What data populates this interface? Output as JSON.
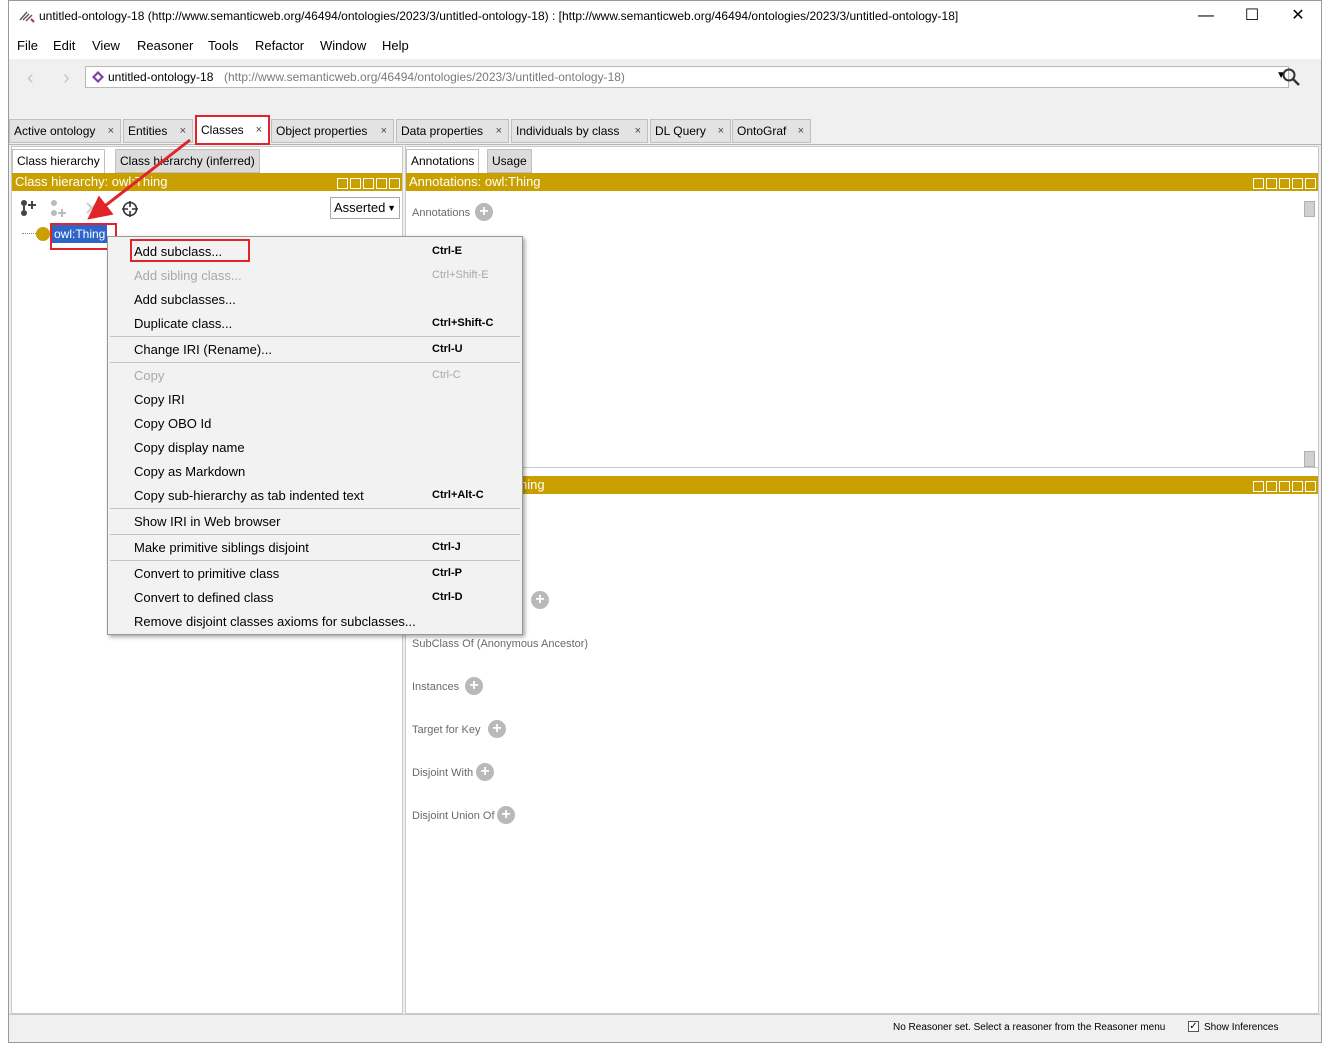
{
  "window": {
    "title": "untitled-ontology-18 (http://www.semanticweb.org/46494/ontologies/2023/3/untitled-ontology-18)  : [http://www.semanticweb.org/46494/ontologies/2023/3/untitled-ontology-18]",
    "app_icon": "protege-icon",
    "minimize": "—",
    "maximize": "☐",
    "close": "✕"
  },
  "menubar": [
    "File",
    "Edit",
    "View",
    "Reasoner",
    "Tools",
    "Refactor",
    "Window",
    "Help"
  ],
  "address": {
    "back": "‹",
    "forward": "›",
    "ontology_name": "untitled-ontology-18",
    "ontology_iri": "(http://www.semanticweb.org/46494/ontologies/2023/3/untitled-ontology-18)",
    "dropdown": "▼"
  },
  "tabs": [
    {
      "label": "Active ontology",
      "close": "×"
    },
    {
      "label": "Entities",
      "close": "×"
    },
    {
      "label": "Classes",
      "close": "×"
    },
    {
      "label": "Object properties",
      "close": "×"
    },
    {
      "label": "Data properties",
      "close": "×"
    },
    {
      "label": "Individuals by class",
      "close": "×"
    },
    {
      "label": "DL Query",
      "close": "×"
    },
    {
      "label": "OntoGraf",
      "close": "×"
    }
  ],
  "left": {
    "subtabs": [
      "Class hierarchy",
      "Class hierarchy (inferred)"
    ],
    "header": "Class hierarchy: owl:Thing",
    "asserted": "Asserted",
    "asserted_arrow": "▼",
    "root_class": "owl:Thing"
  },
  "right": {
    "subtabs": [
      "Annotations",
      "Usage"
    ],
    "annotations_header": "Annotations: owl:Thing",
    "annotations_label": "Annotations",
    "description_header_visible": "hing",
    "sections": [
      {
        "label": "SubClass Of (Anonymous Ancestor)",
        "has_add": false
      },
      {
        "label": "Instances",
        "has_add": true
      },
      {
        "label": "Target for Key",
        "has_add": true
      },
      {
        "label": "Disjoint With",
        "has_add": true
      },
      {
        "label": "Disjoint Union Of",
        "has_add": true
      }
    ],
    "add_symbol": "+"
  },
  "context_menu": {
    "items": [
      {
        "label": "Add subclass...",
        "shortcut": "Ctrl-E",
        "enabled": true
      },
      {
        "label": "Add sibling class...",
        "shortcut": "Ctrl+Shift-E",
        "enabled": false
      },
      {
        "label": "Add subclasses...",
        "shortcut": "",
        "enabled": true
      },
      {
        "label": "Duplicate class...",
        "shortcut": "Ctrl+Shift-C",
        "enabled": true
      },
      {
        "label": "Change IRI (Rename)...",
        "shortcut": "Ctrl-U",
        "enabled": true
      },
      {
        "label": "Copy",
        "shortcut": "Ctrl-C",
        "enabled": false
      },
      {
        "label": "Copy IRI",
        "shortcut": "",
        "enabled": true
      },
      {
        "label": "Copy OBO Id",
        "shortcut": "",
        "enabled": true
      },
      {
        "label": "Copy display name",
        "shortcut": "",
        "enabled": true
      },
      {
        "label": "Copy as Markdown",
        "shortcut": "",
        "enabled": true
      },
      {
        "label": "Copy sub-hierarchy as tab indented text",
        "shortcut": "Ctrl+Alt-C",
        "enabled": true
      },
      {
        "label": "Show IRI in Web browser",
        "shortcut": "",
        "enabled": true
      },
      {
        "label": "Make primitive siblings disjoint",
        "shortcut": "Ctrl-J",
        "enabled": true
      },
      {
        "label": "Convert to primitive class",
        "shortcut": "Ctrl-P",
        "enabled": true
      },
      {
        "label": "Convert to defined class",
        "shortcut": "Ctrl-D",
        "enabled": true
      },
      {
        "label": "Remove disjoint classes axioms for subclasses...",
        "shortcut": "",
        "enabled": true
      }
    ]
  },
  "status": {
    "reasoner": "No Reasoner set. Select a reasoner from the Reasoner menu",
    "show_inferences_checked": "✓",
    "show_inferences": "Show Inferences"
  },
  "colors": {
    "view_header": "#c9a000",
    "selection": "#2e65c8",
    "annotation_red": "#e0242a"
  }
}
